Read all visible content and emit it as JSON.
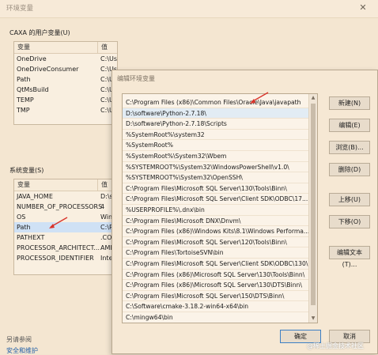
{
  "background_window": {
    "title": "环境变量",
    "close_glyph": "✕",
    "user_section": {
      "label": "CAXA 的用户变量(U)",
      "columns": [
        "变量",
        "值"
      ],
      "rows": [
        {
          "name": "OneDrive",
          "value": "C:\\Users\\CAXA\\OneDrive"
        },
        {
          "name": "OneDriveConsumer",
          "value": "C:\\Users\\CAXA\\OneDrive"
        },
        {
          "name": "Path",
          "value": "C:\\Us"
        },
        {
          "name": "QtMsBuild",
          "value": "C:\\Us"
        },
        {
          "name": "TEMP",
          "value": "C:\\Us"
        },
        {
          "name": "TMP",
          "value": "C:\\Us"
        }
      ]
    },
    "system_section": {
      "label": "系统变量(S)",
      "columns": [
        "变量",
        "值"
      ],
      "rows": [
        {
          "name": "JAVA_HOME",
          "value": "D:\\s"
        },
        {
          "name": "NUMBER_OF_PROCESSORS",
          "value": "4"
        },
        {
          "name": "OS",
          "value": "Win"
        },
        {
          "name": "Path",
          "value": "C:\\P"
        },
        {
          "name": "PATHEXT",
          "value": ".CO"
        },
        {
          "name": "PROCESSOR_ARCHITECT...",
          "value": "AMI"
        },
        {
          "name": "PROCESSOR_IDENTIFIER",
          "value": "Inte"
        }
      ]
    },
    "footer": {
      "see_also": "另请参阅",
      "security": "安全和维护"
    }
  },
  "dialog": {
    "title": "编辑环境变量",
    "paths": [
      "C:\\Program Files (x86)\\Common Files\\Oracle\\Java\\javapath",
      "D:\\software\\Python-2.7.18\\",
      "D:\\software\\Python-2.7.18\\Scripts",
      "%SystemRoot%\\system32",
      "%SystemRoot%",
      "%SystemRoot%\\System32\\Wbem",
      "%SYSTEMROOT%\\System32\\WindowsPowerShell\\v1.0\\",
      "%SYSTEMROOT%\\System32\\OpenSSH\\",
      "C:\\Program Files\\Microsoft SQL Server\\130\\Tools\\Binn\\",
      "C:\\Program Files\\Microsoft SQL Server\\Client SDK\\ODBC\\17...",
      "%USERPROFILE%\\.dnx\\bin",
      "C:\\Program Files\\Microsoft DNX\\Dnvm\\",
      "C:\\Program Files (x86)\\Windows Kits\\8.1\\Windows Performa...",
      "C:\\Program Files\\Microsoft SQL Server\\120\\Tools\\Binn\\",
      "C:\\Program Files\\TortoiseSVN\\bin",
      "C:\\Program Files\\Microsoft SQL Server\\Client SDK\\ODBC\\130\\...",
      "C:\\Program Files (x86)\\Microsoft SQL Server\\130\\Tools\\Binn\\",
      "C:\\Program Files (x86)\\Microsoft SQL Server\\130\\DTS\\Binn\\",
      "C:\\Program Files\\Microsoft SQL Server\\150\\DTS\\Binn\\",
      "C:\\Software\\cmake-3.18.2-win64-x64\\bin",
      "C:\\mingw64\\bin"
    ],
    "selected_index": 1,
    "buttons": {
      "new": "新建(N)",
      "edit": "编辑(E)",
      "browse": "浏览(B)...",
      "delete": "删除(D)",
      "move_up": "上移(U)",
      "move_down": "下移(O)",
      "edit_text": "编辑文本(T)...",
      "ok": "确定",
      "cancel": "取消"
    }
  },
  "watermark": "@稀土掘金技术社区",
  "colors": {
    "arrow": "#d9342b",
    "selection": "#cfe1f5"
  }
}
